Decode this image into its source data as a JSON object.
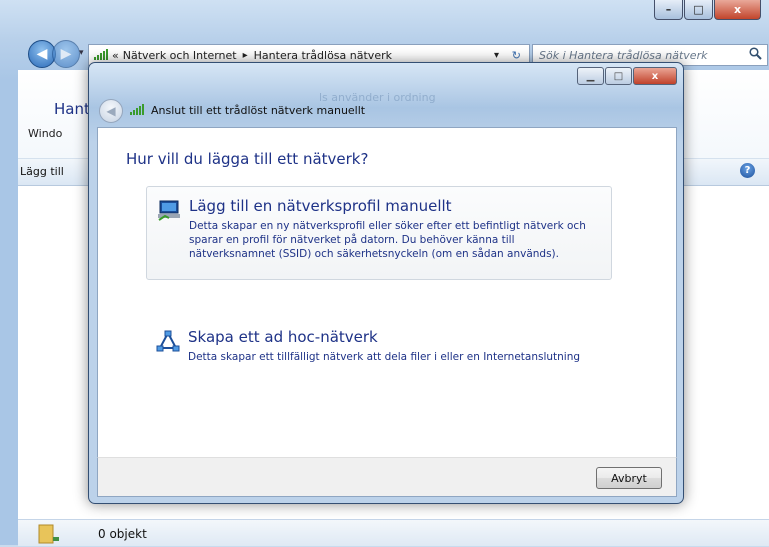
{
  "window": {
    "caption_buttons": {
      "minimize": "–",
      "maximize": "□",
      "close": "x"
    }
  },
  "addressbar": {
    "breadcrumb": [
      {
        "label": "Nätverk och Internet"
      },
      {
        "label": "Hantera trådlösa nätverk"
      }
    ],
    "overflow": "«",
    "separator": "▸",
    "refresh": "↻",
    "dropdown": "▾"
  },
  "search": {
    "placeholder": "Sök i Hantera trådlösa nätverk"
  },
  "background_pane": {
    "title_partial": "Hant",
    "subtitle_partial": "Windo",
    "toolbar_partial": "Lägg till",
    "faded_heading": "ls använder i ordning"
  },
  "status": {
    "text": "0 objekt"
  },
  "dialog": {
    "title": "Anslut till ett trådlöst nätverk manuellt",
    "heading": "Hur vill du lägga till ett nätverk?",
    "options": [
      {
        "icon": "network-profile-icon",
        "title": "Lägg till en nätverksprofil manuellt",
        "description": "Detta skapar en ny nätverksprofil eller söker efter ett befintligt nätverk och sparar en profil för nätverket på datorn. Du behöver känna till nätverksnamnet (SSID) och säkerhetsnyckeln (om en sådan används)."
      },
      {
        "icon": "adhoc-network-icon",
        "title": "Skapa ett ad hoc-nätverk",
        "description": "Detta skapar ett tillfälligt nätverk att dela filer i eller en Internetanslutning"
      }
    ],
    "cancel_label": "Avbryt"
  },
  "colors": {
    "link_blue": "#1e3287",
    "close_red": "#c2452c"
  }
}
